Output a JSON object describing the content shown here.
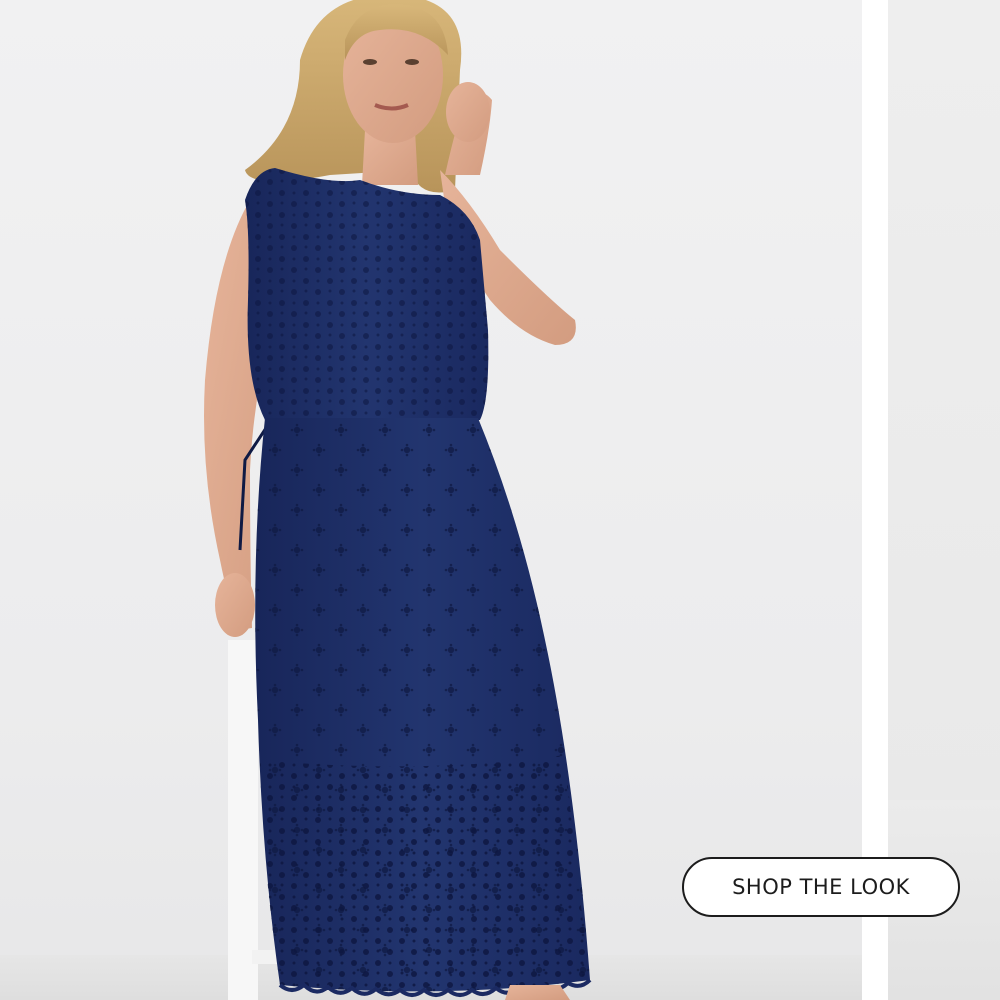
{
  "cta": {
    "label": "SHOP THE LOOK"
  },
  "colors": {
    "background": "#eeeeef",
    "dress": "#1e2e68",
    "button_border": "#1c1c1c",
    "button_fill": "#ffffff"
  }
}
